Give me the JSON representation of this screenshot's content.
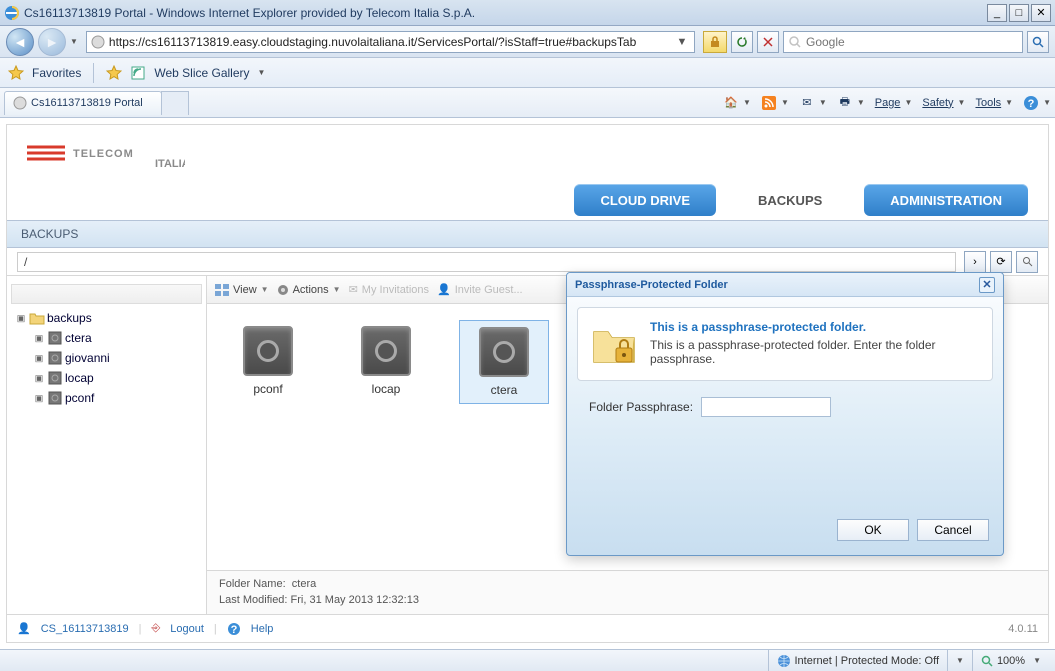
{
  "window": {
    "title": "Cs16113713819 Portal - Windows Internet Explorer provided by Telecom Italia S.p.A."
  },
  "nav": {
    "url_plain": "https://cs16113713819.easy.cloudstaging.nuvolaitaliana.it/ServicesPortal/?isStaff=true#backupsTab",
    "search_placeholder": "Google"
  },
  "favorites": {
    "label": "Favorites",
    "webslice": "Web Slice Gallery"
  },
  "tabs": {
    "active": "Cs16113713819 Portal"
  },
  "cmdbar": {
    "page": "Page",
    "safety": "Safety",
    "tools": "Tools"
  },
  "brand": {
    "name": "TELECOM",
    "sub": "ITALIA"
  },
  "mainnav": {
    "cloud_drive": "CLOUD DRIVE",
    "backups": "BACKUPS",
    "administration": "ADMINISTRATION"
  },
  "section": {
    "title": "BACKUPS",
    "path": "/"
  },
  "toolbar": {
    "view": "View",
    "actions": "Actions",
    "my_invitations": "My Invitations",
    "invite_guest": "Invite Guest..."
  },
  "tree": {
    "root": "backups",
    "children": [
      "ctera",
      "giovanni",
      "locap",
      "pconf"
    ]
  },
  "items": [
    {
      "name": "pconf"
    },
    {
      "name": "locap"
    },
    {
      "name": "ctera"
    }
  ],
  "status": {
    "folder_label": "Folder Name:",
    "folder_value": "ctera",
    "modified_label": "Last Modified:",
    "modified_value": "Fri, 31 May 2013 12:32:13"
  },
  "footer": {
    "user": "CS_16113713819",
    "logout": "Logout",
    "help": "Help",
    "version": "4.0.11"
  },
  "dialog": {
    "title": "Passphrase-Protected Folder",
    "heading": "This is a passphrase-protected folder.",
    "text": "This is a passphrase-protected folder. Enter the folder passphrase.",
    "field_label": "Folder Passphrase:",
    "ok": "OK",
    "cancel": "Cancel"
  },
  "iestatus": {
    "mode": "Internet | Protected Mode: Off",
    "zoom": "100%"
  }
}
